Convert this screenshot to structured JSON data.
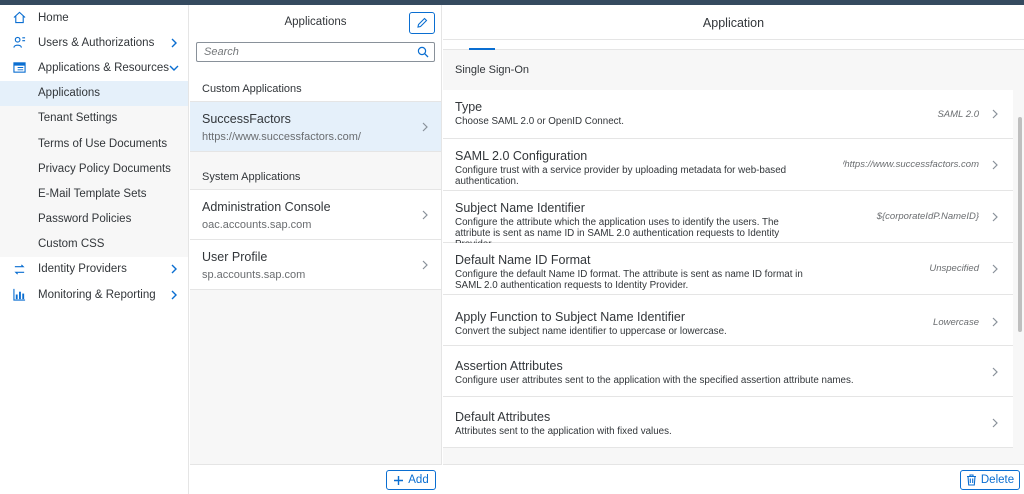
{
  "nav": {
    "items": [
      {
        "label": "Home",
        "icon": "home-icon"
      },
      {
        "label": "Users & Authorizations",
        "icon": "users-icon"
      },
      {
        "label": "Applications & Resources",
        "icon": "applications-icon"
      },
      {
        "label": "Applications",
        "selected": true
      },
      {
        "label": "Tenant Settings"
      },
      {
        "label": "Terms of Use Documents"
      },
      {
        "label": "Privacy Policy Documents"
      },
      {
        "label": "E-Mail Template Sets"
      },
      {
        "label": "Password Policies"
      },
      {
        "label": "Custom CSS"
      },
      {
        "label": "Identity Providers",
        "icon": "identity-providers-icon"
      },
      {
        "label": "Monitoring & Reporting",
        "icon": "monitoring-icon"
      }
    ]
  },
  "list": {
    "title": "Applications",
    "search_placeholder": "Search",
    "custom_group": "Custom Applications",
    "system_group": "System Applications",
    "custom_items": [
      {
        "title": "SuccessFactors",
        "desc": "https://www.successfactors.com/"
      }
    ],
    "system_items": [
      {
        "title": "Administration Console",
        "desc": "oac.accounts.sap.com"
      },
      {
        "title": "User Profile",
        "desc": "sp.accounts.sap.com"
      }
    ],
    "add_label": "Add"
  },
  "detail": {
    "title": "Application",
    "section": "Single Sign-On",
    "rows": [
      {
        "title": "Type",
        "desc": "Choose SAML 2.0 or OpenID Connect.",
        "value": "SAML 2.0"
      },
      {
        "title": "SAML 2.0 Configuration",
        "desc": "Configure trust with a service provider by uploading metadata for web-based authentication.",
        "value": "https://www.successfactors.com/"
      },
      {
        "title": "Subject Name Identifier",
        "desc": "Configure the attribute which the application uses to identify the users. The attribute is sent as name ID in SAML 2.0 authentication requests to Identity Provider.",
        "value": "${corporateIdP.NameID}"
      },
      {
        "title": "Default Name ID Format",
        "desc": "Configure the default Name ID format. The attribute is sent as name ID format in SAML 2.0 authentication requests to Identity Provider.",
        "value": "Unspecified"
      },
      {
        "title": "Apply Function to Subject Name Identifier",
        "desc": "Convert the subject name identifier to uppercase or lowercase.",
        "value": "Lowercase"
      },
      {
        "title": "Assertion Attributes",
        "desc": "Configure user attributes sent to the application with the specified assertion attribute names.",
        "value": ""
      },
      {
        "title": "Default Attributes",
        "desc": "Attributes sent to the application with fixed values.",
        "value": ""
      }
    ],
    "delete_label": "Delete"
  },
  "colors": {
    "accent": "#0a6ed1",
    "selected_bg": "#e5f0fa",
    "topbar": "#354a5f"
  }
}
